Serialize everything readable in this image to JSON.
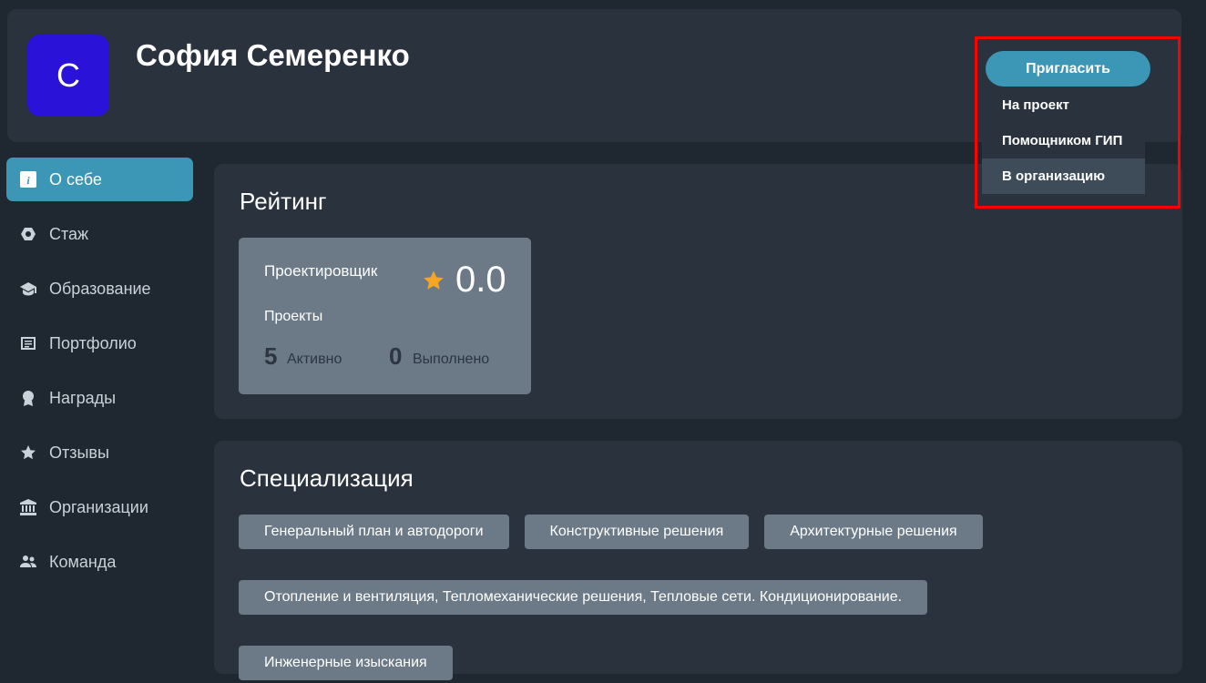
{
  "profile": {
    "avatar_letter": "С",
    "name": "София Семеренко",
    "avatar_color": "#2a12d9"
  },
  "invite": {
    "button_label": "Пригласить",
    "menu": [
      "На проект",
      "Помощником ГИП",
      "В организацию"
    ],
    "hovered_index": 2
  },
  "sidebar": {
    "active_index": 0,
    "items": [
      {
        "label": "О себе",
        "icon": "info-icon"
      },
      {
        "label": "Стаж",
        "icon": "hexagon-icon"
      },
      {
        "label": "Образование",
        "icon": "graduation-cap-icon"
      },
      {
        "label": "Портфолио",
        "icon": "document-icon"
      },
      {
        "label": "Награды",
        "icon": "award-icon"
      },
      {
        "label": "Отзывы",
        "icon": "star-icon"
      },
      {
        "label": "Организации",
        "icon": "institution-icon"
      },
      {
        "label": "Команда",
        "icon": "people-icon"
      }
    ]
  },
  "rating": {
    "title": "Рейтинг",
    "role": "Проектировщик",
    "score": "0.0",
    "projects_label": "Проекты",
    "active_count": "5",
    "active_label": "Активно",
    "done_count": "0",
    "done_label": "Выполнено"
  },
  "specialization": {
    "title": "Специализация",
    "tags": [
      "Генеральный план и автодороги",
      "Конструктивные решения",
      "Архитектурные решения",
      "Отопление и вентиляция, Тепломеханические решения, Тепловые сети. Кондиционирование.",
      "Инженерные изыскания"
    ]
  },
  "colors": {
    "accent": "#3b97b5",
    "background": "#1f2730",
    "panel": "#29323d",
    "tag": "#6c7a88",
    "star": "#f5a623",
    "highlight": "#ff0000"
  }
}
